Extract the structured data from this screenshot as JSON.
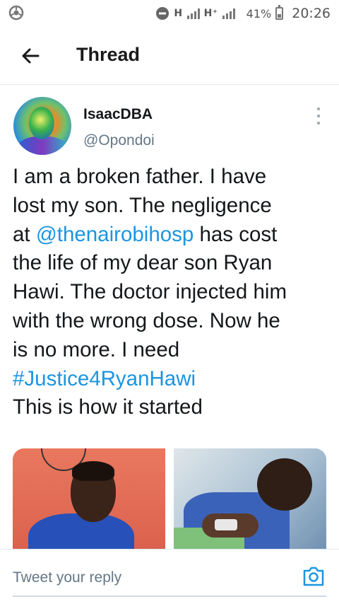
{
  "status_bar": {
    "network_1": "H",
    "network_2": "H⁺",
    "battery": "41%",
    "time": "20:26",
    "battery_level": 0.41
  },
  "header": {
    "title": "Thread",
    "back_icon": "arrow-left-icon"
  },
  "tweet": {
    "name": "IsaacDBA",
    "handle": "@Opondoi",
    "lines": [
      [
        "I am a broken father. I have"
      ],
      [
        "lost my son. The negligence"
      ],
      [
        "at ",
        "@thenairobihosp",
        " has cost"
      ],
      [
        "the life of my dear son Ryan"
      ],
      [
        "Hawi. The doctor injected him"
      ],
      [
        "with the wrong dose. Now he"
      ],
      [
        "is no more. I need"
      ],
      [
        "#Justice4RyanHawi"
      ],
      [
        "This is how it started"
      ]
    ],
    "mention": "@thenairobihosp",
    "hashtag": "#Justice4RyanHawi",
    "link_color": "#1b95e0"
  },
  "reply": {
    "placeholder": "Tweet your reply",
    "camera_icon": "camera-icon"
  }
}
